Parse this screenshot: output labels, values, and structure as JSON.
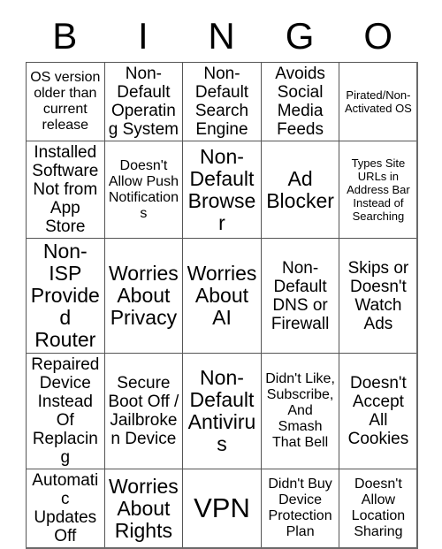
{
  "card": {
    "title_letters": [
      "B",
      "I",
      "N",
      "G",
      "O"
    ],
    "rows": [
      [
        {
          "text": "OS version older than current release",
          "size": "t-md"
        },
        {
          "text": "Non-Default Operating System",
          "size": "t-lg"
        },
        {
          "text": "Non-Default Search Engine",
          "size": "t-lg"
        },
        {
          "text": "Avoids Social Media Feeds",
          "size": "t-lg"
        },
        {
          "text": "Pirated/Non-Activated OS",
          "size": "t-sm"
        }
      ],
      [
        {
          "text": "Installed Software Not from App Store",
          "size": "t-lg"
        },
        {
          "text": "Doesn't Allow Push Notifications",
          "size": "t-md"
        },
        {
          "text": "Non-Default Browser",
          "size": "t-xl"
        },
        {
          "text": "Ad Blocker",
          "size": "t-xl"
        },
        {
          "text": "Types Site URLs in Address Bar Instead of Searching",
          "size": "t-sm"
        }
      ],
      [
        {
          "text": "Non-ISP Provided Router",
          "size": "t-xl"
        },
        {
          "text": "Worries About Privacy",
          "size": "t-xl"
        },
        {
          "text": "Worries About AI",
          "size": "t-xl"
        },
        {
          "text": "Non-Default DNS or Firewall",
          "size": "t-lg"
        },
        {
          "text": "Skips or Doesn't Watch Ads",
          "size": "t-lg"
        }
      ],
      [
        {
          "text": "Repaired Device Instead Of Replacing",
          "size": "t-lg"
        },
        {
          "text": "Secure Boot Off / Jailbroken Device",
          "size": "t-lg"
        },
        {
          "text": "Non-Default Antivirus",
          "size": "t-xl"
        },
        {
          "text": "Didn't Like, Subscribe, And Smash That Bell",
          "size": "t-md"
        },
        {
          "text": "Doesn't Accept All Cookies",
          "size": "t-lg"
        }
      ],
      [
        {
          "text": "Automatic Updates Off",
          "size": "t-lg"
        },
        {
          "text": "Worries About Rights",
          "size": "t-xl"
        },
        {
          "text": "VPN",
          "size": "t-xxl"
        },
        {
          "text": "Didn't Buy Device Protection Plan",
          "size": "t-md"
        },
        {
          "text": "Doesn't Allow Location Sharing",
          "size": "t-md"
        }
      ]
    ]
  },
  "colors": {
    "background": "#ffffff",
    "text": "#000000",
    "grid_line": "#555555",
    "grid_outer_line": "#6a6a6a"
  }
}
